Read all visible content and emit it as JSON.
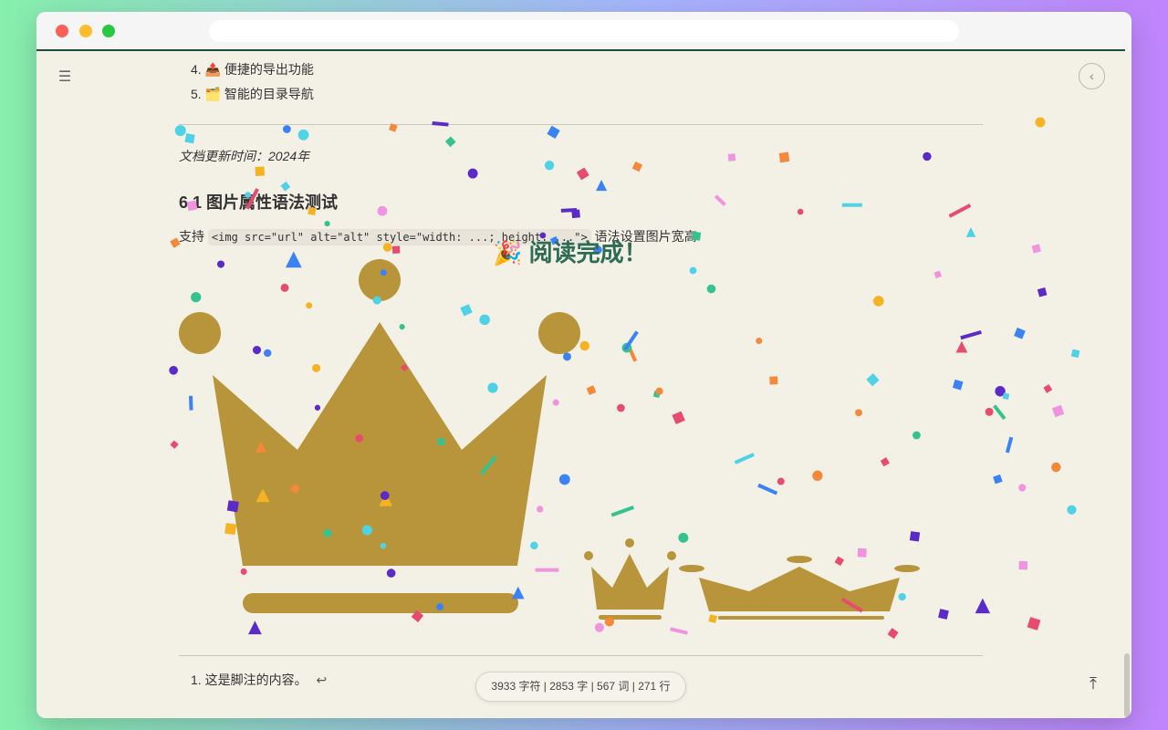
{
  "toc": {
    "items": [
      {
        "num": "4.",
        "emoji": "📤",
        "label": "便捷的导出功能"
      },
      {
        "num": "5.",
        "emoji": "🗂️",
        "label": "智能的目录导航"
      }
    ]
  },
  "document": {
    "updated_text": "文档更新时间：2024年",
    "section_title": "6.1 图片属性语法测试",
    "para_prefix": "支持",
    "para_code": "<img src=\"url\" alt=\"alt\" style=\"width: ...; height: ...\">",
    "para_suffix": "语法设置图片宽高"
  },
  "images": {
    "alt_text": "crown",
    "crown_color": "#b8953a"
  },
  "footnote": {
    "num": "1.",
    "text": "这是脚注的内容。",
    "back_symbol": "↩"
  },
  "overlay": {
    "emoji": "🎉",
    "text": "阅读完成！",
    "color": "#2e6b55"
  },
  "stats": {
    "text": "3933 字符 | 2853 字 | 567 词 | 271 行"
  },
  "icons": {
    "menu": "hamburger-icon",
    "back": "chevron-left-icon",
    "top": "arrow-up-to-line-icon"
  },
  "colors": {
    "page_bg": "#f3f0e6",
    "accent": "#1f4d3a",
    "confetti": [
      "#e74c6f",
      "#4fd1e6",
      "#f5b324",
      "#5b2bc8",
      "#34c38f",
      "#f093e0",
      "#3b82f6",
      "#f4883b"
    ]
  }
}
